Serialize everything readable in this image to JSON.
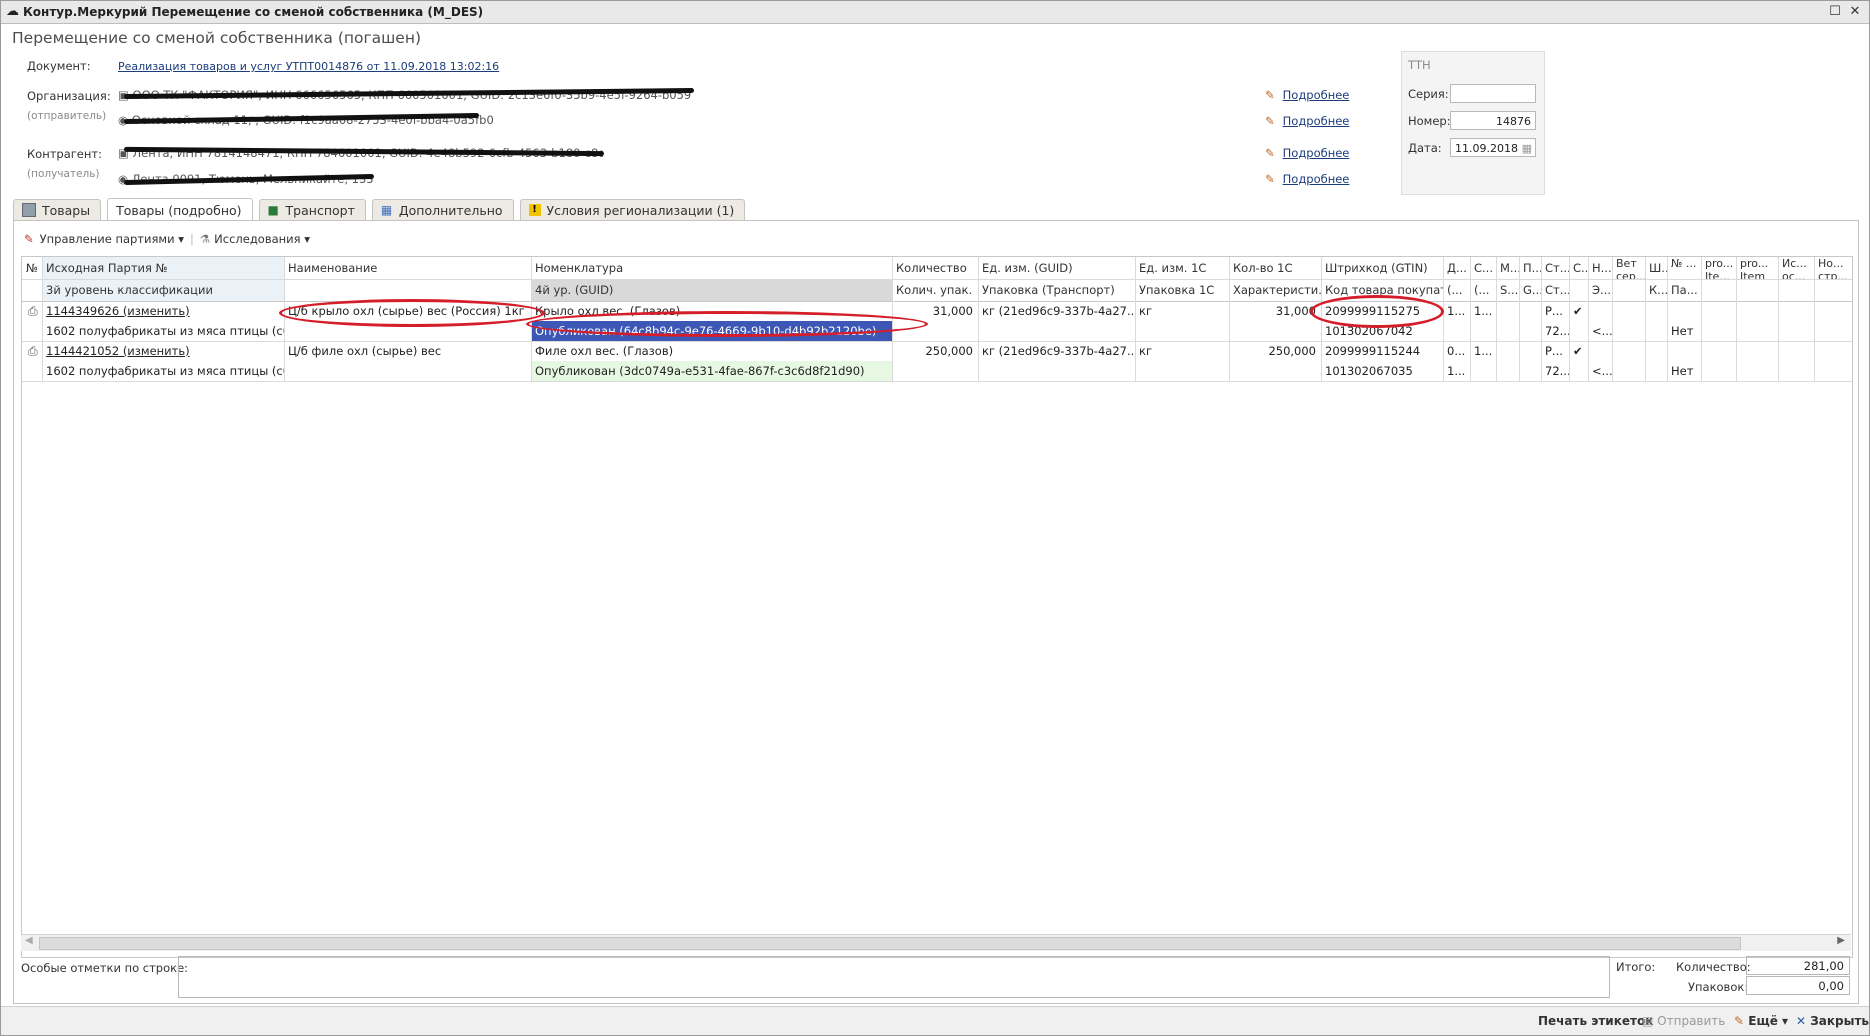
{
  "window": {
    "title": "Контур.Меркурий Перемещение со сменой собственника (M_DES)"
  },
  "doc_title": "Перемещение со сменой собственника (погашен)",
  "header": {
    "document_label": "Документ:",
    "document_link": "Реализация товаров и услуг УТПТ0014876 от 11.09.2018 13:02:16",
    "org_label": "Организация:",
    "org_sub": "(отправитель)",
    "org_value": "ООО ТК \"ФАКТОРИЯ\", ИНН 666656565, КПП 660501001, GUID: 2c13e6f0-35b9-4e5f-9264-b0597cf91e8a",
    "org_address": "Основной склад 11, , GUID: f1c9aa08-2753-4e0f-bba4-0a5fb0cf55ae",
    "contr_label": "Контрагент:",
    "contr_sub": "(получатель)",
    "contr_value": "Лента, ИНН 7814148471, КПП 784601001, GUID: 4e48b592-6cfb-4563-b180-c8d554b053df",
    "contr_address": "Лента 0091, Тюмень, Мельникайте, 133",
    "more_label": "Подробнее"
  },
  "tth": {
    "caption": "ТТН",
    "series_label": "Серия:",
    "series_value": "",
    "number_label": "Номер:",
    "number_value": "14876",
    "date_label": "Дата:",
    "date_value": "11.09.2018"
  },
  "tabs": [
    {
      "label": "Товары"
    },
    {
      "label": "Товары (подробно)"
    },
    {
      "label": "Транспорт"
    },
    {
      "label": "Дополнительно"
    },
    {
      "label": "Условия регионализации (1)"
    }
  ],
  "toolbar": {
    "batch_mgmt": "Управление партиями",
    "research": "Исследования"
  },
  "grid": {
    "header_top": [
      "№",
      "Исходная Партия №",
      "Наименование",
      "Номенклатура",
      "Количество",
      "Ед. изм. (GUID)",
      "Ед. изм. 1С",
      "Кол-во 1С",
      "Штрихкод (GTIN)",
      "Д...",
      "С...",
      "М...",
      "П...",
      "Ст...",
      "С...",
      "Н...",
      "Вет сер...",
      "Ш...",
      "№ ...",
      "pro... Ite...",
      "pro... Item",
      "Ис... ос...",
      "Но... стр..."
    ],
    "header_bottom": [
      "",
      "3й уровень классификации",
      "",
      "4й ур. (GUID)",
      "Колич. упак.",
      "Упаковка (Транспорт)",
      "Упаковка 1С",
      "Характеристи...",
      "Код товара покупат...",
      "(...",
      "(...",
      "S...",
      "G...",
      "Ст...",
      "",
      "Э...",
      "",
      "К...",
      "Па...",
      "",
      "",
      "",
      ""
    ],
    "rows": [
      {
        "batch": "1144349626 (изменить)",
        "class3": "1602 полуфабрикаты из мяса птицы (c0...",
        "name": "Ц/б крыло охл (сырье) вес (Россия) 1кг",
        "nomenclature": "Крыло охл вес. (Глазов)",
        "guid_status": "Опубликован (64c8b94c-9e76-4669-9b10-d4b92b2120be)",
        "qty": "31,000",
        "unit_guid": "кг (21ed96c9-337b-4a27...",
        "unit1c": "кг",
        "qty1c": "31,000",
        "gtin": "2099999115275",
        "buyer_code": "101302067042",
        "d1": "1...",
        "c1": "1...",
        "st1": "Р...",
        "st2": "72...",
        "chk": "✔",
        "n2": "<...",
        "pa": "Нет"
      },
      {
        "batch": "1144421052 (изменить)",
        "class3": "1602 полуфабрикаты из мяса птицы (c0...",
        "name": "Ц/б филе охл (сырье) вес",
        "nomenclature": "Филе охл вес. (Глазов)",
        "guid_status": "Опубликован (3dc0749a-e531-4fae-867f-c3c6d8f21d90)",
        "qty": "250,000",
        "unit_guid": "кг (21ed96c9-337b-4a27...",
        "unit1c": "кг",
        "qty1c": "250,000",
        "gtin": "2099999115244",
        "buyer_code": "101302067035",
        "d1": "0...",
        "d2": "1...",
        "c1": "1...",
        "st1": "Р...",
        "st2": "72...",
        "chk": "✔",
        "n2": "<...",
        "pa": "Нет"
      }
    ]
  },
  "footer": {
    "notes_label": "Особые отметки по строке:",
    "total_label": "Итого:",
    "qty_label": "Количество:",
    "qty_value": "281,00",
    "pack_label": "Упаковок:",
    "pack_value": "0,00"
  },
  "bottombar": {
    "print": "Печать этикеток",
    "send": "Отправить",
    "more": "Ещё",
    "close": "Закрыть"
  },
  "colors": {
    "annotation": "#d51e2a",
    "selected": "#3d57b7",
    "published": "#e6f7e2"
  }
}
